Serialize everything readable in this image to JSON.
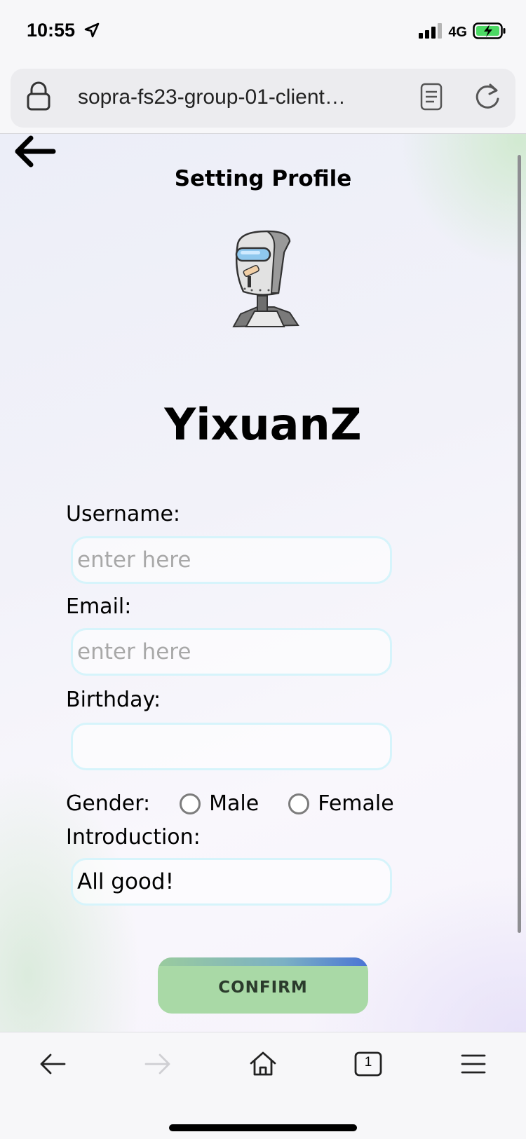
{
  "status_bar": {
    "time": "10:55",
    "network": "4G"
  },
  "browser": {
    "url": "sopra-fs23-group-01-client…"
  },
  "page": {
    "title": "Setting Profile",
    "profile_name": "YixuanZ",
    "username": {
      "label": "Username:",
      "placeholder": "enter here",
      "value": ""
    },
    "email": {
      "label": "Email:",
      "placeholder": "enter here",
      "value": ""
    },
    "birthday": {
      "label": "Birthday:",
      "value": ""
    },
    "gender": {
      "label": "Gender:",
      "options": [
        "Male",
        "Female"
      ]
    },
    "introduction": {
      "label": "Introduction:",
      "value": "All good!"
    },
    "confirm_label": "CONFIRM"
  },
  "toolbar": {
    "tab_count": "1"
  },
  "colors": {
    "input_border": "#d6f4fb",
    "confirm_button": "#a9d9a6",
    "battery": "#4cd964"
  },
  "icons": [
    "location-arrow-icon",
    "signal-icon",
    "battery-icon",
    "lock-icon",
    "reader-icon",
    "reload-icon",
    "back-arrow-icon",
    "forward-arrow-icon",
    "home-icon",
    "tabs-icon",
    "menu-icon"
  ]
}
